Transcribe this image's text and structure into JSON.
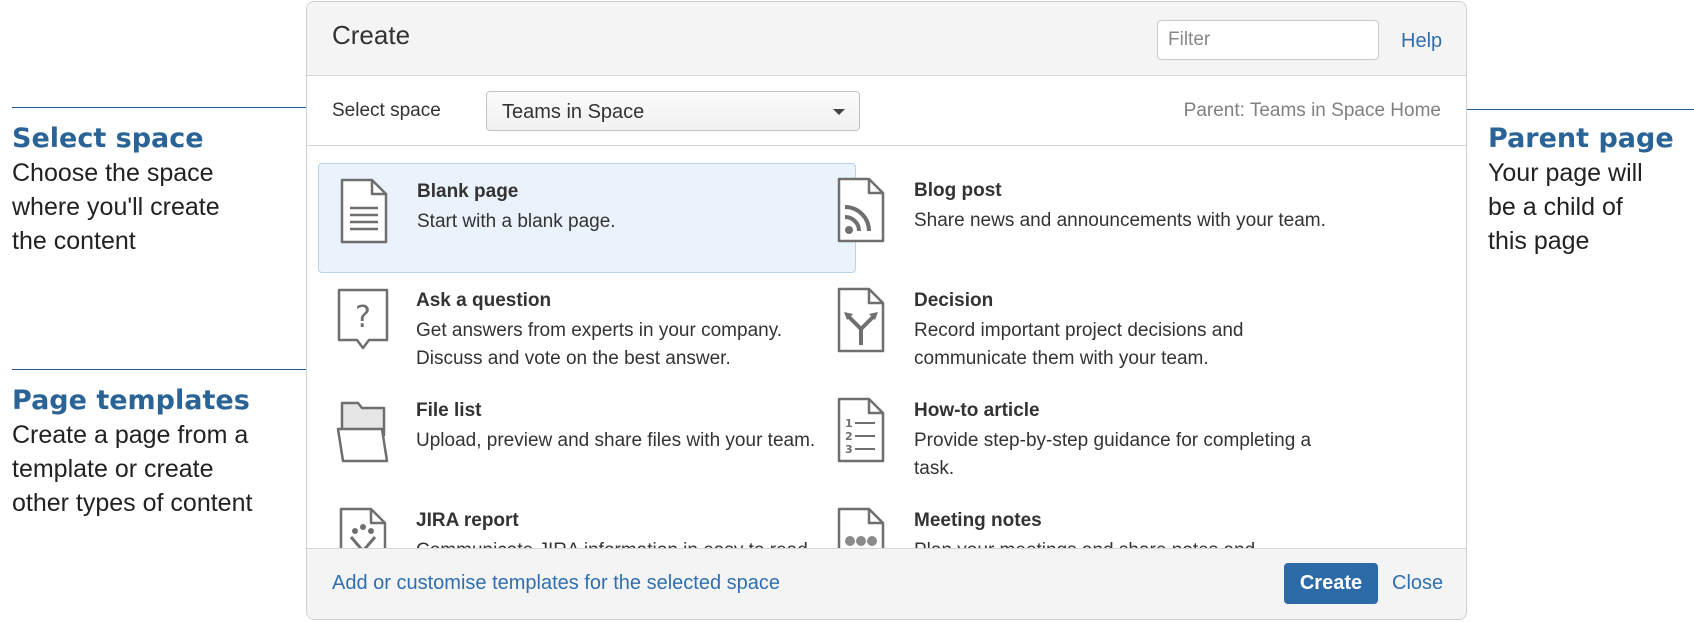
{
  "annotations": {
    "select_space": {
      "title": "Select space",
      "lines": [
        "Choose the space",
        "where you'll create",
        "the content"
      ]
    },
    "page_templates": {
      "title": "Page templates",
      "lines": [
        "Create a page from a",
        "template or create",
        "other types of content"
      ]
    },
    "parent_page": {
      "title": "Parent page",
      "lines": [
        "Your page will",
        "be a child of",
        "this page"
      ]
    }
  },
  "dialog": {
    "title": "Create",
    "filter_placeholder": "Filter",
    "help_label": "Help",
    "space_label": "Select space",
    "space_value": "Teams in Space",
    "parent_text": "Parent: Teams in Space Home",
    "templates": [
      {
        "name": "Blank page",
        "desc": "Start with a blank page.",
        "icon": "blank-page-icon",
        "selected": true
      },
      {
        "name": "Blog post",
        "desc": "Share news and announcements with your team.",
        "icon": "rss-icon"
      },
      {
        "name": "Ask a question",
        "desc": "Get answers from experts in your company. Discuss and vote on the best answer.",
        "icon": "question-icon"
      },
      {
        "name": "Decision",
        "desc": "Record important project decisions and communicate them with your team.",
        "icon": "decision-icon"
      },
      {
        "name": "File list",
        "desc": "Upload, preview and share files with your team.",
        "icon": "folder-icon"
      },
      {
        "name": "How-to article",
        "desc": "Provide step-by-step guidance for completing a task.",
        "icon": "numbered-list-icon"
      },
      {
        "name": "JIRA report",
        "desc": "Communicate JIRA information in easy to read",
        "icon": "jira-report-icon"
      },
      {
        "name": "Meeting notes",
        "desc": "Plan your meetings and share notes and",
        "icon": "meeting-notes-icon"
      }
    ],
    "footer_link": "Add or customise templates for the selected space",
    "create_label": "Create",
    "close_label": "Close"
  }
}
